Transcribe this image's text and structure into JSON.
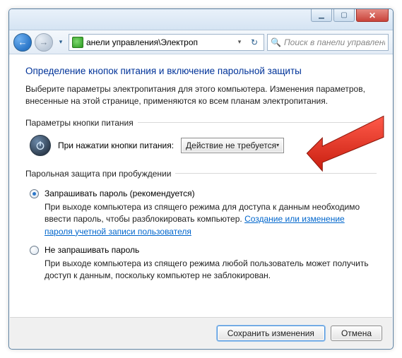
{
  "titlebar": {
    "min_glyph": "▁",
    "max_glyph": "▢",
    "close_glyph": "✕"
  },
  "nav": {
    "back_glyph": "←",
    "fwd_glyph": "→",
    "chev_glyph": "▾",
    "address_text": "анели управления\\Электроп",
    "address_drop": "▾",
    "refresh_glyph": "↻",
    "search_placeholder": "Поиск в панели управления",
    "search_glyph": "🔍"
  },
  "main": {
    "heading": "Определение кнопок питания и включение парольной защиты",
    "intro": "Выберите параметры электропитания для этого компьютера. Изменения параметров, внесенные на этой странице, применяются ко всем планам электропитания.",
    "group_power": {
      "legend": "Параметры кнопки питания",
      "row_label": "При нажатии кнопки питания:",
      "combo_value": "Действие не требуется",
      "combo_tri": "▾"
    },
    "group_wake": {
      "legend": "Парольная защита при пробуждении",
      "opt1_label": "Запрашивать пароль (рекомендуется)",
      "opt1_desc_a": "При выходе компьютера из спящего режима для доступа к данным необходимо ввести пароль, чтобы разблокировать компьютер. ",
      "opt1_link": "Создание или изменение пароля учетной записи пользователя",
      "opt2_label": "Не запрашивать пароль",
      "opt2_desc": "При выходе компьютера из спящего режима любой пользователь может получить доступ к данным, поскольку компьютер не заблокирован."
    }
  },
  "footer": {
    "save_label": "Сохранить изменения",
    "cancel_label": "Отмена"
  }
}
